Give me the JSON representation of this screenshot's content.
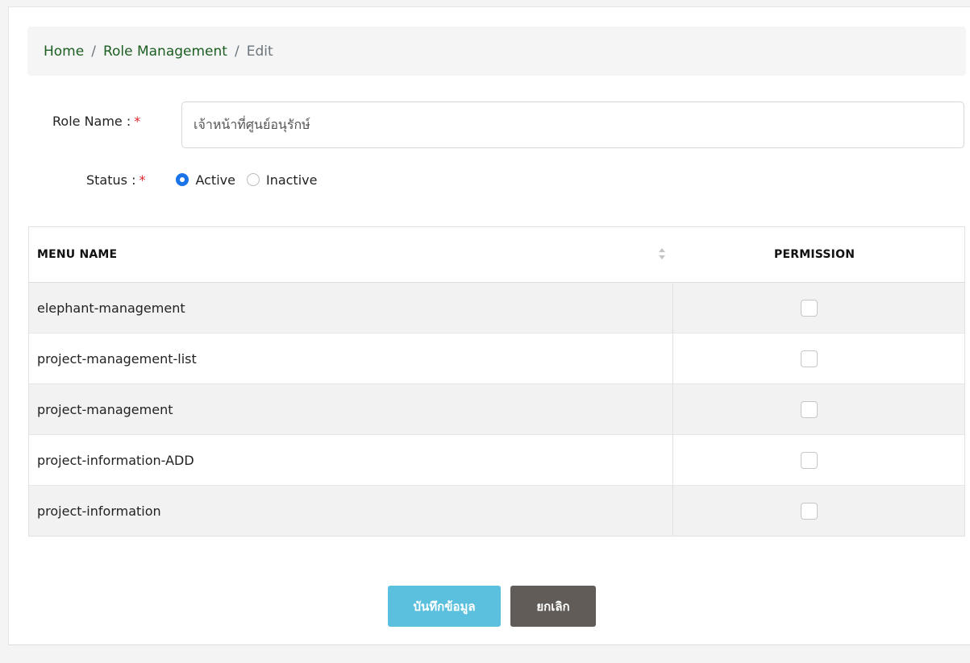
{
  "breadcrumb": {
    "home": "Home",
    "separator": "/",
    "section": "Role Management",
    "current": "Edit"
  },
  "form": {
    "role_name_label": "Role Name :",
    "required_mark": "*",
    "role_name_value": "เจ้าหน้าที่ศูนย์อนุรักษ์",
    "status_label": "Status :",
    "status_options": [
      {
        "label": "Active",
        "selected": true
      },
      {
        "label": "Inactive",
        "selected": false
      }
    ]
  },
  "table": {
    "headers": {
      "menu_name": "MENU NAME",
      "permission": "PERMISSION"
    },
    "sort_icon": "sort-icon",
    "rows": [
      {
        "menu_name": "elephant-management",
        "permission": false
      },
      {
        "menu_name": "project-management-list",
        "permission": false
      },
      {
        "menu_name": "project-management",
        "permission": false
      },
      {
        "menu_name": "project-information-ADD",
        "permission": false
      },
      {
        "menu_name": "project-information",
        "permission": false
      }
    ]
  },
  "actions": {
    "save_label": "บันทึกข้อมูล",
    "cancel_label": "ยกเลิก"
  },
  "colors": {
    "link_green": "#1d5e22",
    "save_button": "#5bc0de",
    "cancel_button": "#615c57",
    "radio_selected": "#1a73e8",
    "required": "#d9262c"
  }
}
